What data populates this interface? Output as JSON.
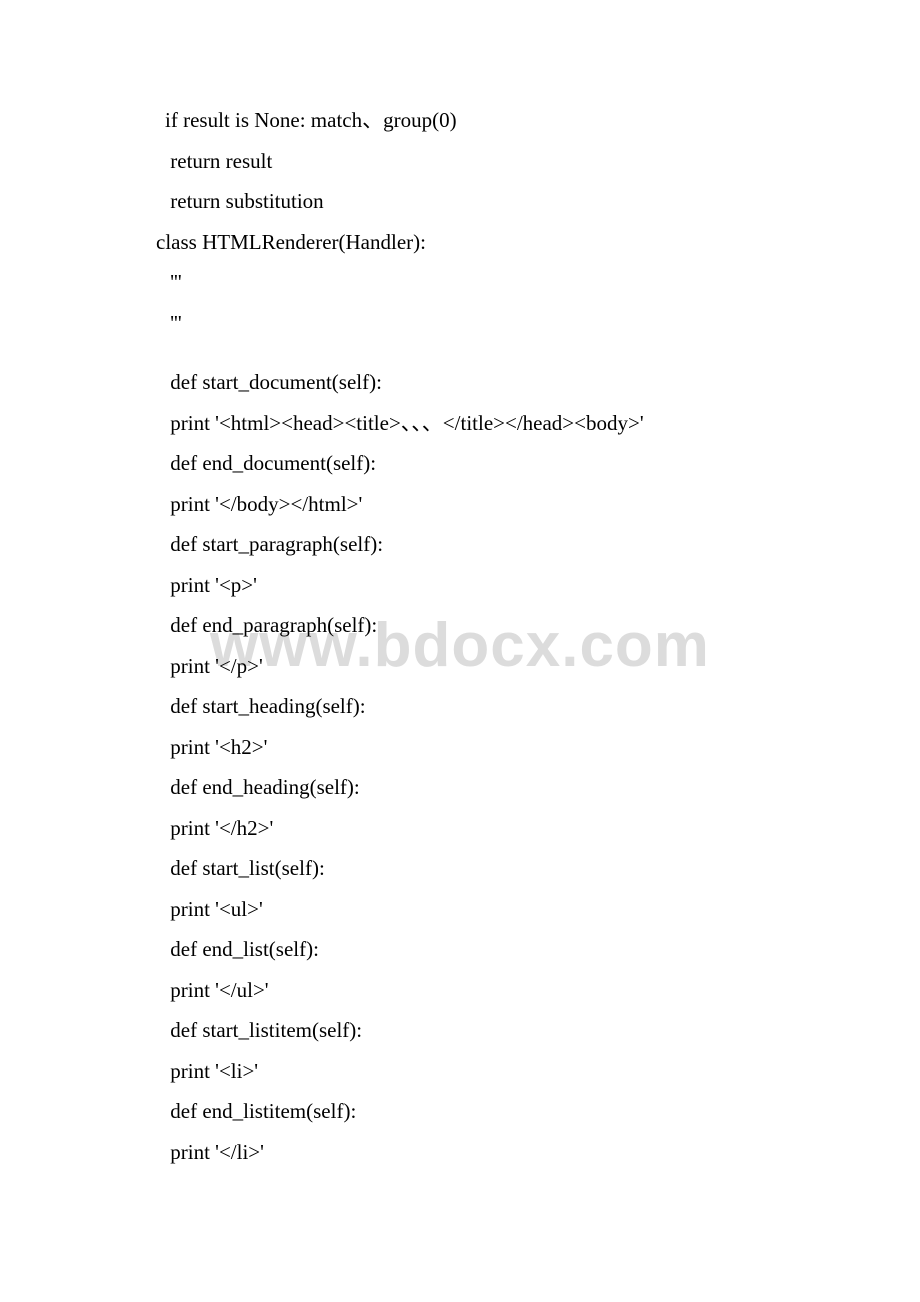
{
  "watermark": "www.bdocx.com",
  "lines": [
    {
      "text": "if result is None: match、group(0)",
      "class": ""
    },
    {
      "text": " return result",
      "class": ""
    },
    {
      "text": " return substitution",
      "class": ""
    },
    {
      "text": "class HTMLRenderer(Handler):",
      "class": "outdent"
    },
    {
      "text": " '''",
      "class": ""
    },
    {
      "text": " '''",
      "class": ""
    },
    {
      "text": "",
      "class": "gap"
    },
    {
      "text": " def start_document(self):",
      "class": ""
    },
    {
      "text": " print '<html><head><title>、、、</title></head><body>'",
      "class": ""
    },
    {
      "text": " def end_document(self):",
      "class": ""
    },
    {
      "text": " print '</body></html>'",
      "class": ""
    },
    {
      "text": " def start_paragraph(self):",
      "class": ""
    },
    {
      "text": " print '<p>'",
      "class": ""
    },
    {
      "text": " def end_paragraph(self):",
      "class": ""
    },
    {
      "text": " print '</p>'",
      "class": ""
    },
    {
      "text": " def start_heading(self):",
      "class": ""
    },
    {
      "text": " print '<h2>'",
      "class": ""
    },
    {
      "text": " def end_heading(self):",
      "class": ""
    },
    {
      "text": " print '</h2>'",
      "class": ""
    },
    {
      "text": " def start_list(self):",
      "class": ""
    },
    {
      "text": " print '<ul>'",
      "class": ""
    },
    {
      "text": " def end_list(self):",
      "class": ""
    },
    {
      "text": " print '</ul>'",
      "class": ""
    },
    {
      "text": " def start_listitem(self):",
      "class": ""
    },
    {
      "text": " print '<li>'",
      "class": ""
    },
    {
      "text": " def end_listitem(self):",
      "class": ""
    },
    {
      "text": " print '</li>'",
      "class": ""
    }
  ]
}
